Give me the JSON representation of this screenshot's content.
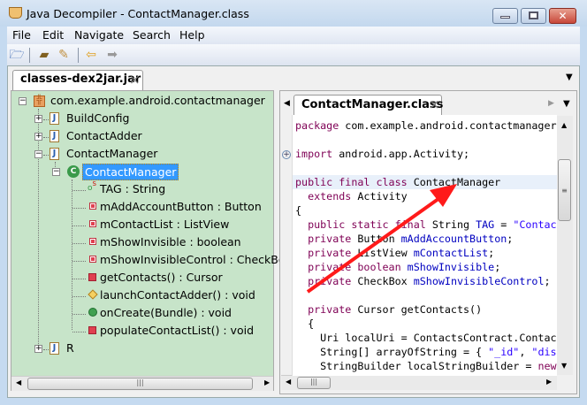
{
  "window": {
    "title": "Java Decompiler - ContactManager.class",
    "close_glyph": "✕"
  },
  "menu": [
    "File",
    "Edit",
    "Navigate",
    "Search",
    "Help"
  ],
  "toolbar": {
    "icons": [
      "open-file-icon",
      "open-type-icon",
      "search-icon",
      "back-arrow-icon",
      "forward-arrow-icon"
    ]
  },
  "outer_tab": {
    "label": "classes-dex2jar.jar",
    "close": "×"
  },
  "tree": {
    "root": "com.example.android.contactmanager",
    "classes": [
      "BuildConfig",
      "ContactAdder",
      "ContactManager",
      "R"
    ],
    "selected": "ContactManager",
    "members": [
      {
        "label": "TAG : String",
        "icon": "static-field-icon"
      },
      {
        "label": "mAddAccountButton : Button",
        "icon": "private-field-icon"
      },
      {
        "label": "mContactList : ListView",
        "icon": "private-field-icon"
      },
      {
        "label": "mShowInvisible : boolean",
        "icon": "private-field-icon"
      },
      {
        "label": "mShowInvisibleControl : CheckBox",
        "icon": "private-field-icon"
      },
      {
        "label": "getContacts() : Cursor",
        "icon": "private-method-icon"
      },
      {
        "label": "launchContactAdder() : void",
        "icon": "package-method-icon"
      },
      {
        "label": "onCreate(Bundle) : void",
        "icon": "public-method-icon"
      },
      {
        "label": "populateContactList() : void",
        "icon": "private-method-icon"
      }
    ]
  },
  "editor": {
    "tab_label": "ContactManager.class",
    "close": "×",
    "colors": {
      "keyword": "#7f0055",
      "field": "#0000c0",
      "string": "#2a00ff",
      "highlight": "#e8f0fa",
      "arrow": "#ff1a1a"
    },
    "lines": [
      [
        [
          "package",
          "kw"
        ],
        [
          " com.example.android.contactmanager;",
          ""
        ]
      ],
      [],
      [
        [
          "import",
          "kw"
        ],
        [
          " android.app.Activity;",
          ""
        ]
      ],
      [],
      [
        [
          "public final class",
          "kw"
        ],
        [
          " ContactManager",
          ""
        ]
      ],
      [
        [
          "  extends",
          "kw"
        ],
        [
          " Activity",
          ""
        ]
      ],
      [
        [
          "{",
          ""
        ]
      ],
      [
        [
          "  public static final",
          "kw"
        ],
        [
          " String ",
          ""
        ],
        [
          "TAG",
          "fd"
        ],
        [
          " = ",
          ""
        ],
        [
          "\"ContactManager\"",
          "st"
        ]
      ],
      [
        [
          "  private",
          "kw"
        ],
        [
          " Button ",
          ""
        ],
        [
          "mAddAccountButton",
          "fd"
        ],
        [
          ";",
          ""
        ]
      ],
      [
        [
          "  private",
          "kw"
        ],
        [
          " ListView ",
          ""
        ],
        [
          "mContactList",
          "fd"
        ],
        [
          ";",
          ""
        ]
      ],
      [
        [
          "  private boolean",
          "kw"
        ],
        [
          " ",
          ""
        ],
        [
          "mShowInvisible",
          "fd"
        ],
        [
          ";",
          ""
        ]
      ],
      [
        [
          "  private",
          "kw"
        ],
        [
          " CheckBox ",
          ""
        ],
        [
          "mShowInvisibleControl",
          "fd"
        ],
        [
          ";",
          ""
        ]
      ],
      [],
      [
        [
          "  private",
          "kw"
        ],
        [
          " Cursor getContacts()",
          ""
        ]
      ],
      [
        [
          "  {",
          ""
        ]
      ],
      [
        [
          "    Uri localUri = ContactsContract.Contacts",
          ""
        ]
      ],
      [
        [
          "    String[] arrayOfString = { ",
          ""
        ],
        [
          "\"_id\"",
          "st"
        ],
        [
          ", ",
          ""
        ],
        [
          "\"display_name\"",
          "st"
        ]
      ],
      [
        [
          "    StringBuilder localStringBuilder = ",
          ""
        ],
        [
          "new",
          "kw"
        ]
      ]
    ]
  }
}
